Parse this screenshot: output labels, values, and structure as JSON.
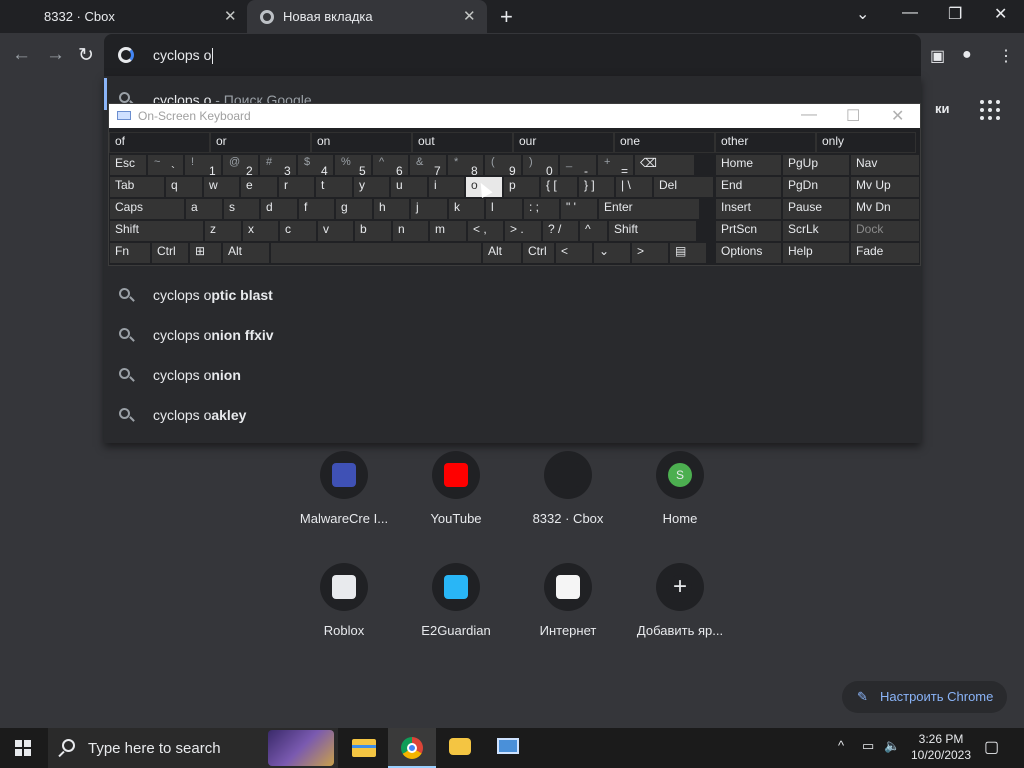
{
  "tabs": [
    {
      "title": "8332 · Cbox",
      "close": "✕"
    },
    {
      "title": "Новая вкладка",
      "close": "✕"
    }
  ],
  "newtab_symbol": "+",
  "window_controls": {
    "minimize": "⌄",
    "min": "—",
    "restore": "❐",
    "close": "✕"
  },
  "nav": {
    "back": "←",
    "forward": "→",
    "reload": "↻"
  },
  "omnibox": {
    "text": "cyclops o"
  },
  "toolbar_right": {
    "sidepanel": "▣",
    "profile": "●",
    "menu": "⋮"
  },
  "suggestions": [
    {
      "prefix": "cyclops o",
      "rest": " - Поиск Google"
    },
    {
      "prefix": "cyclops o",
      "bold": "ptic blast"
    },
    {
      "prefix": "cyclops o",
      "bold": "nion ffxiv"
    },
    {
      "prefix": "cyclops o",
      "bold": "nion"
    },
    {
      "prefix": "cyclops o",
      "bold": "akley"
    }
  ],
  "ntp_right_text": "ки",
  "osk": {
    "title": "On-Screen Keyboard",
    "controls": {
      "min": "—",
      "max": "☐",
      "close": "✕"
    },
    "predictions": [
      "of",
      "or",
      "on",
      "out",
      "our",
      "one",
      "other",
      "only"
    ],
    "row1": [
      {
        "t": "Esc"
      },
      {
        "s": "~",
        "m": "`"
      },
      {
        "s": "!",
        "m": "1"
      },
      {
        "s": "@",
        "m": "2"
      },
      {
        "s": "#",
        "m": "3"
      },
      {
        "s": "$",
        "m": "4"
      },
      {
        "s": "%",
        "m": "5"
      },
      {
        "s": "^",
        "m": "6"
      },
      {
        "s": "&",
        "m": "7"
      },
      {
        "s": "*",
        "m": "8"
      },
      {
        "s": "(",
        "m": "9"
      },
      {
        "s": ")",
        "m": "0"
      },
      {
        "s": "_",
        "m": "-"
      },
      {
        "s": "+",
        "m": "="
      },
      {
        "t": "⌫"
      }
    ],
    "row2": [
      "Tab",
      "q",
      "w",
      "e",
      "r",
      "t",
      "y",
      "u",
      "i",
      "o",
      "p",
      "{ [",
      "} ]",
      "| \\",
      "Del"
    ],
    "row3": [
      "Caps",
      "a",
      "s",
      "d",
      "f",
      "g",
      "h",
      "j",
      "k",
      "l",
      ": ;",
      "\" '",
      "Enter"
    ],
    "row4": [
      "Shift",
      "z",
      "x",
      "c",
      "v",
      "b",
      "n",
      "m",
      "< ,",
      "> .",
      "? /",
      "^",
      "Shift"
    ],
    "row5": [
      "Fn",
      "Ctrl",
      "⊞",
      "Alt",
      "",
      "Alt",
      "Ctrl",
      "<",
      "⌄",
      ">",
      "▤"
    ],
    "side": [
      [
        "Home",
        "PgUp",
        "Nav"
      ],
      [
        "End",
        "PgDn",
        "Mv Up"
      ],
      [
        "Insert",
        "Pause",
        "Mv Dn"
      ],
      [
        "PrtScn",
        "ScrLk",
        "Dock"
      ],
      [
        "Options",
        "Help",
        "Fade"
      ]
    ]
  },
  "shortcuts": [
    {
      "label": "MalwareCre I...",
      "icon": "malwarecrew-icon",
      "color": "#3f51b5"
    },
    {
      "label": "YouTube",
      "icon": "youtube-icon",
      "color": "#ff0000"
    },
    {
      "label": "8332 · Cbox",
      "icon": "cbox-icon",
      "color": "#202124"
    },
    {
      "label": "Home",
      "icon": "home-s-icon",
      "color": "#4caf50",
      "letter": "S"
    },
    {
      "label": "Roblox",
      "icon": "roblox-icon",
      "color": "#e8eaed"
    },
    {
      "label": "E2Guardian",
      "icon": "cloud-lock-icon",
      "color": "#29b6f6"
    },
    {
      "label": "Интернет",
      "icon": "internet-icon",
      "color": "#f5f5f5"
    },
    {
      "label": "Добавить яр...",
      "icon": "plus-icon",
      "color": "#202124",
      "letter": "+"
    }
  ],
  "customize": {
    "label": "Настроить Chrome",
    "icon": "pencil-icon"
  },
  "taskbar": {
    "search_placeholder": "Type here to search",
    "clock_time": "3:26 PM",
    "clock_date": "10/20/2023",
    "tray": {
      "chevron": "^",
      "network": "▭",
      "volume": "🔈",
      "notifications": "▢"
    }
  }
}
